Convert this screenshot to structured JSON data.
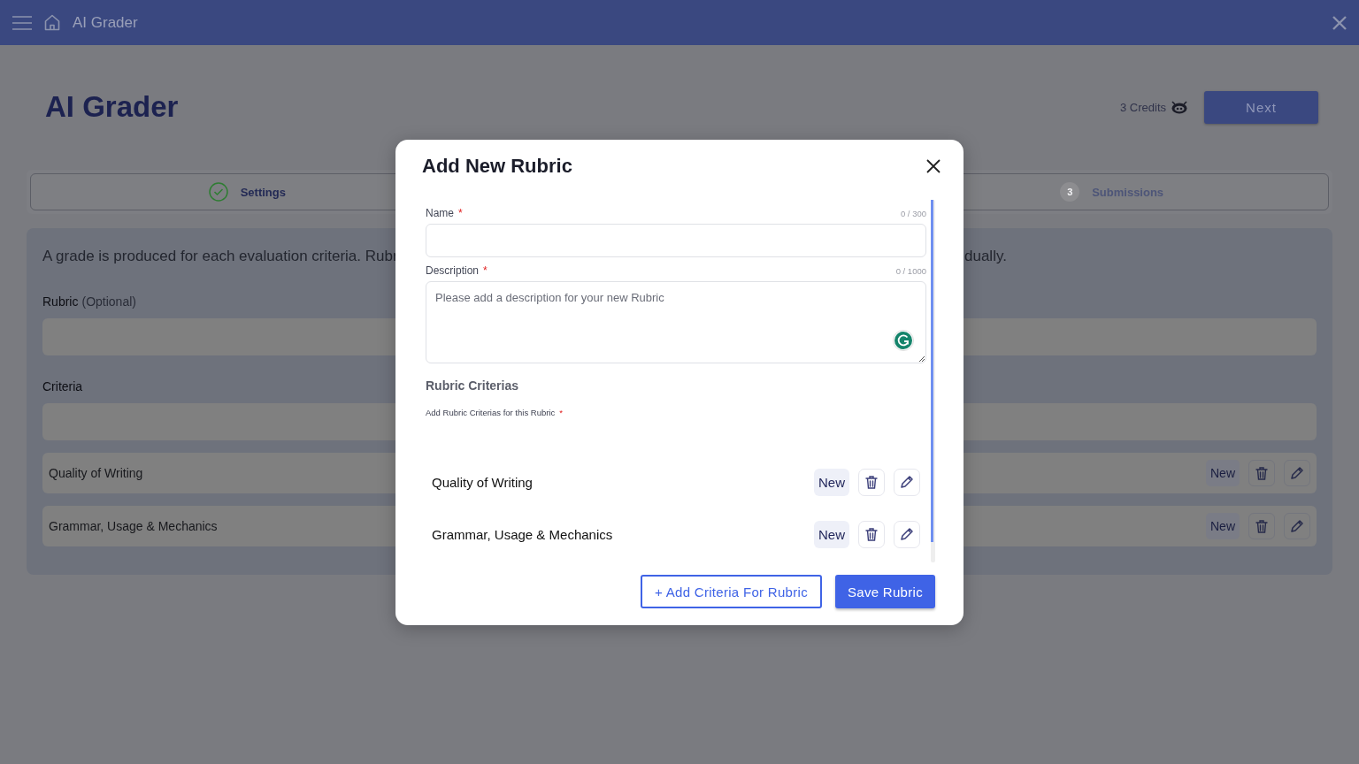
{
  "header": {
    "title": "AI Grader"
  },
  "page": {
    "title": "AI Grader",
    "credits": "3 Credits",
    "next_button": "Next"
  },
  "steps": [
    {
      "label": "Settings",
      "completed": true
    },
    {
      "number": "3",
      "label": "Submissions",
      "completed": false
    }
  ],
  "intro": {
    "text_left": "A grade is produced for each evaluation criteria. Rubr",
    "text_right": "dually."
  },
  "rubric_field": {
    "label": "Rubric",
    "hint": "(Optional)"
  },
  "criteria_field": {
    "label": "Criteria"
  },
  "criteria": [
    {
      "name": "Quality of Writing",
      "badge": "New"
    },
    {
      "name": "Grammar, Usage & Mechanics",
      "badge": "New"
    }
  ],
  "dialog": {
    "title": "Add New Rubric",
    "fields": [
      {
        "kind": "input",
        "label": "Name",
        "required_mark": "*",
        "counter": "0 / 300"
      },
      {
        "kind": "textarea",
        "label": "Description",
        "required_mark": "*",
        "counter": "0 / 1000",
        "placeholder": "Please add a description for your new Rubric"
      }
    ],
    "section_title": "Rubric Criterias",
    "section_hint": "Add Rubric Criterias for this Rubric",
    "section_required_mark": "*",
    "criteria": [
      {
        "name": "Quality of Writing",
        "badge": "New"
      },
      {
        "name": "Grammar, Usage & Mechanics",
        "badge": "New"
      }
    ],
    "buttons": [
      {
        "kind": "outline",
        "label": "+ Add Criteria For Rubric"
      },
      {
        "kind": "primary",
        "label": "Save Rubric"
      }
    ]
  }
}
